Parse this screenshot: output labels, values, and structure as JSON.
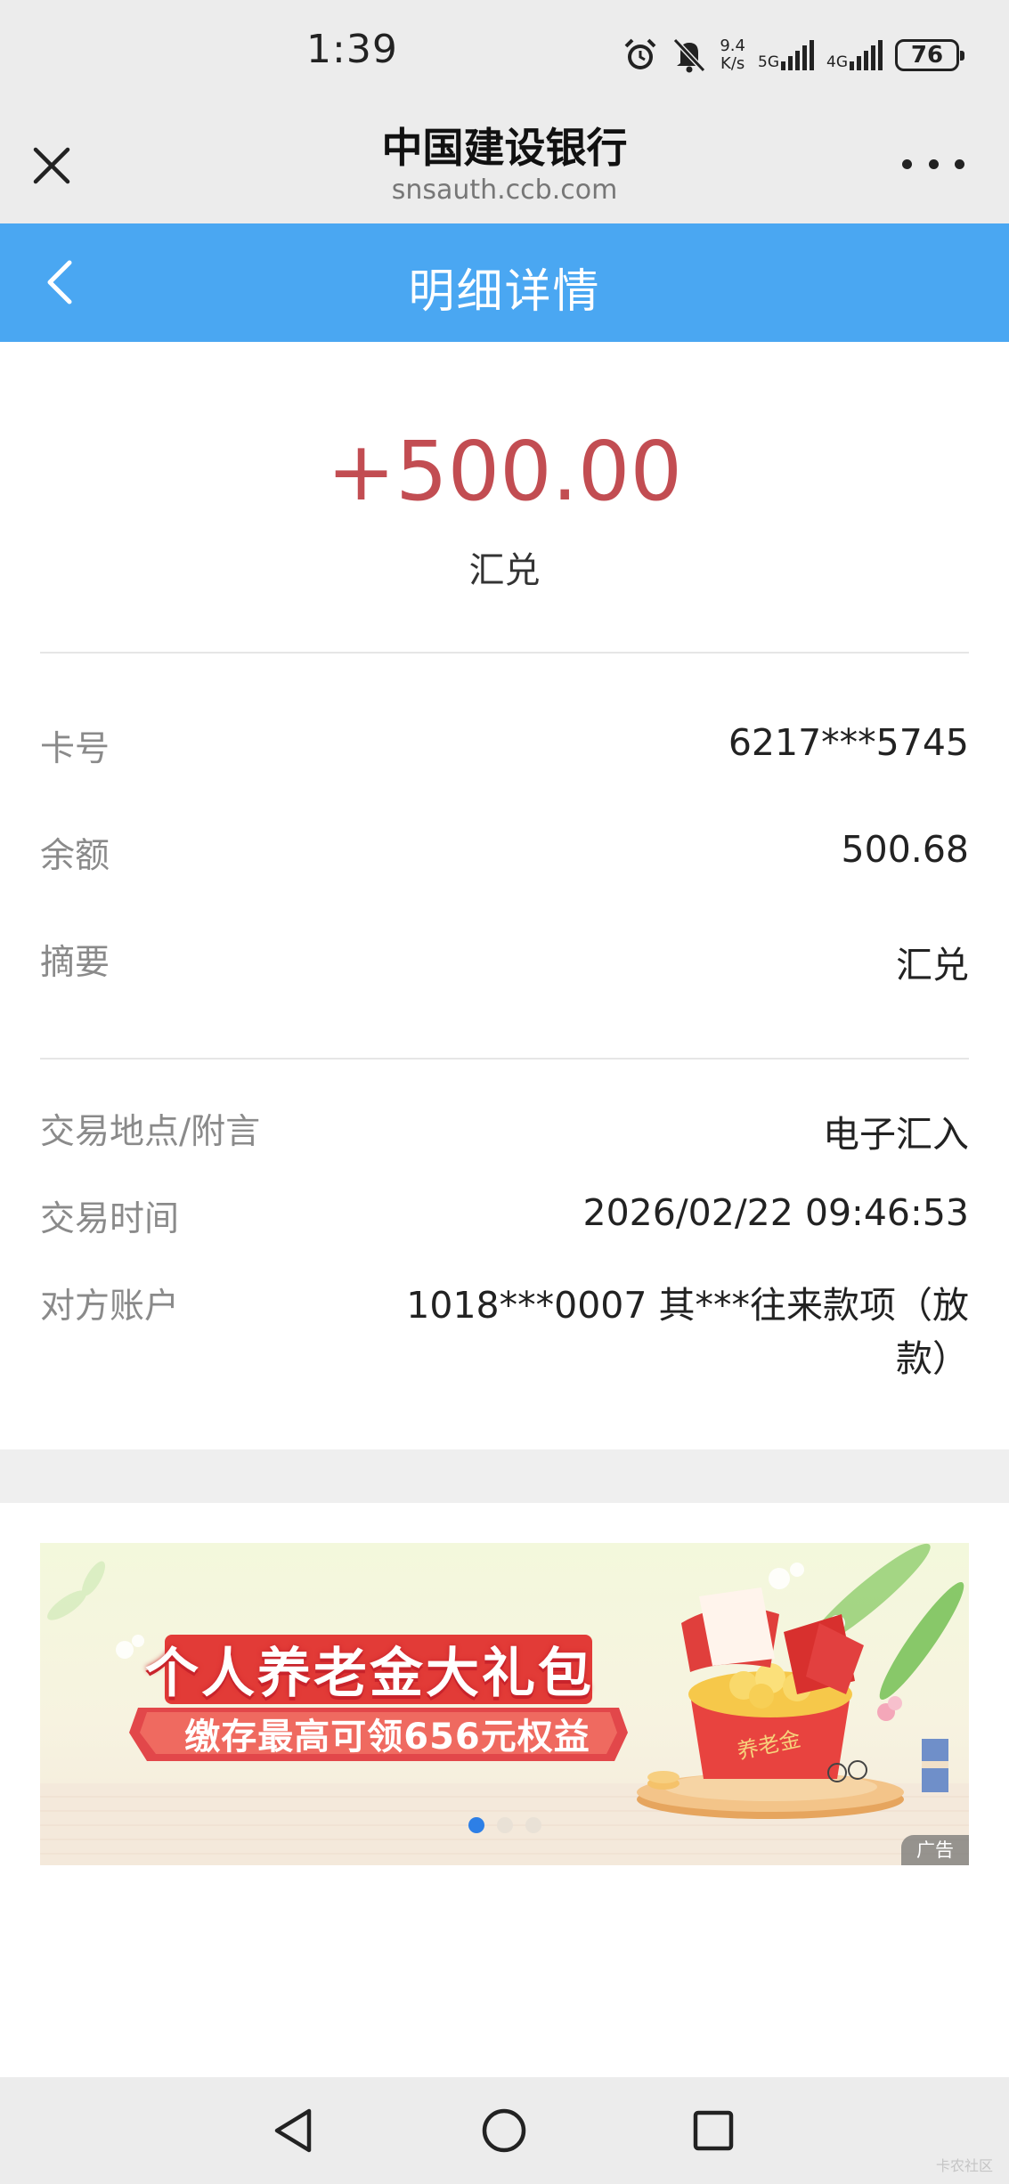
{
  "status_bar": {
    "time": "1:39",
    "net_speed_value": "9.4",
    "net_speed_unit": "K/s",
    "sim1_label": "5G",
    "sim2_label": "4G",
    "battery": "76"
  },
  "browser": {
    "title": "中国建设银行",
    "domain": "snsauth.ccb.com",
    "icons": {
      "close": "close-icon",
      "more": "more-icon"
    }
  },
  "nav": {
    "title": "明细详情",
    "back_icon": "chevron-left-icon",
    "color": "#4aa7f2"
  },
  "transaction": {
    "amount": "+500.00",
    "amount_color": "#c24d52",
    "type": "汇兑"
  },
  "details_primary": [
    {
      "label": "卡号",
      "value": "6217***5745"
    },
    {
      "label": "余额",
      "value": "500.68"
    },
    {
      "label": "摘要",
      "value": "汇兑"
    }
  ],
  "details_secondary": [
    {
      "label": "交易地点/附言",
      "value": "电子汇入"
    },
    {
      "label": "交易时间",
      "value": "2026/02/22 09:46:53"
    },
    {
      "label": "对方账户",
      "value": "1018***0007  其***往来款项（放款）"
    }
  ],
  "banner": {
    "title": "个人养老金大礼包",
    "subtitle": "缴存最高可领656元权益",
    "box_label": "养老金",
    "ad_label": "广告",
    "page_count": 3,
    "active_page": 1
  },
  "system_nav": {
    "back_icon": "triangle-back-icon",
    "home_icon": "circle-home-icon",
    "recents_icon": "square-recents-icon"
  },
  "watermark": "卡农社区"
}
